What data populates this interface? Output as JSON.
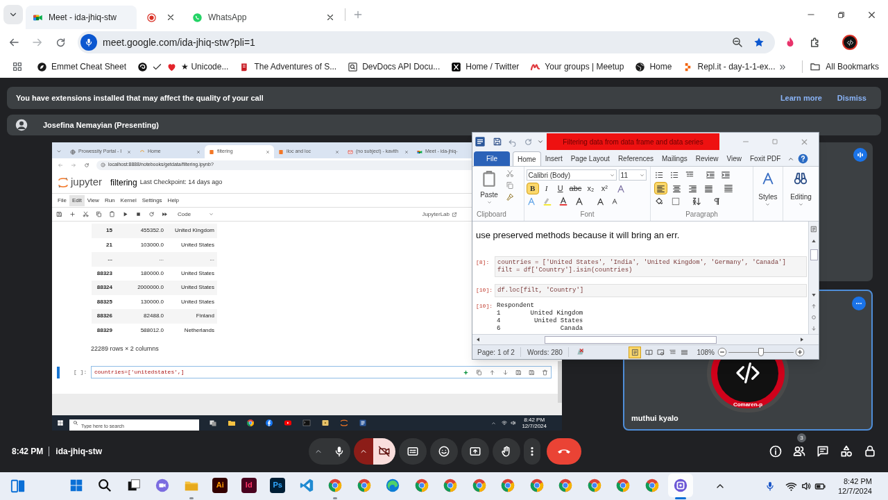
{
  "browser": {
    "tabs": [
      {
        "kind": "meet",
        "title": "Meet - ida-jhiq-stw",
        "selected": true
      },
      {
        "kind": "recording",
        "selected": false
      },
      {
        "kind": "whatsapp",
        "title": "WhatsApp",
        "selected": false
      }
    ],
    "address": "meet.google.com/ida-jhiq-stw?pli=1",
    "bookmarks": [
      {
        "kind": "emmet",
        "label": "Emmet Cheat Sheet"
      },
      {
        "kind": "unicode",
        "label": "★ Unicode..."
      },
      {
        "kind": "pg",
        "label": "The Adventures of S..."
      },
      {
        "kind": "devdocs",
        "label": "DevDocs API Docu..."
      },
      {
        "kind": "x",
        "label": "Home / Twitter"
      },
      {
        "kind": "meetup",
        "label": "Your groups | Meetup"
      },
      {
        "kind": "globe",
        "label": "Home"
      },
      {
        "kind": "replit",
        "label": "Repl.it - day-1-1-ex..."
      }
    ],
    "bookmarks_overflow": "»",
    "all_bookmarks": "All Bookmarks"
  },
  "meet": {
    "notice": {
      "text": "You have extensions installed that may affect the quality of your call",
      "actions": [
        "Learn more",
        "Dismiss"
      ]
    },
    "presenter": "Josefina Nemayian (Presenting)",
    "shared_screen": {
      "tabs": [
        {
          "kind": "globe",
          "title": "Prowessity Portal - I",
          "selected": false
        },
        {
          "kind": "home",
          "title": "Home",
          "selected": false
        },
        {
          "kind": "notebook",
          "title": "filtering",
          "selected": true
        },
        {
          "kind": "notebook",
          "title": "iloc and loc",
          "selected": false
        },
        {
          "kind": "mail",
          "title": "(no subject) - kavith",
          "selected": false
        },
        {
          "kind": "meet",
          "title": "Meet - ida-jhiq-",
          "selected": false
        }
      ],
      "url": "localhost:8888/notebooks/getdata/filtering.ipynb?",
      "app_name": "jupyter",
      "notebook": "filtering",
      "checkpoint": "Last Checkpoint: 14 days ago",
      "menu": [
        {
          "label": "File",
          "selected": false
        },
        {
          "label": "Edit",
          "selected": true
        },
        {
          "label": "View",
          "selected": false
        },
        {
          "label": "Run",
          "selected": false
        },
        {
          "label": "Kernel",
          "selected": false
        },
        {
          "label": "Settings",
          "selected": false
        },
        {
          "label": "Help",
          "selected": false
        }
      ],
      "cell_type": "Code",
      "jupyterlab": "JupyterLab",
      "output_rows": [
        {
          "index": "15",
          "value": "455352.0",
          "country": "United Kingdom"
        },
        {
          "index": "21",
          "value": "103000.0",
          "country": "United States"
        },
        {
          "index": "...",
          "value": "...",
          "country": "..."
        },
        {
          "index": "88323",
          "value": "180000.0",
          "country": "United States"
        },
        {
          "index": "88324",
          "value": "2000000.0",
          "country": "United States"
        },
        {
          "index": "88325",
          "value": "130000.0",
          "country": "United States"
        },
        {
          "index": "88326",
          "value": "82488.0",
          "country": "Finland"
        },
        {
          "index": "88329",
          "value": "588012.0",
          "country": "Netherlands"
        }
      ],
      "shape": "22289 rows × 2 columns",
      "prompt": "[ ]:",
      "code": "countries=['unitedstates',]",
      "search_placeholder": "Type here to search",
      "time": "8:42 PM",
      "date": "12/7/2024"
    },
    "tiles": [
      {
        "speaking": true,
        "selected": false
      },
      {
        "speaking": false,
        "selected": true,
        "name": "muthui kyalo",
        "avatar_text": "Comaren-p"
      }
    ],
    "time": "8:42 PM",
    "meeting_code": "ida-jhiq-stw",
    "controls": [
      {
        "kind": "mic",
        "on": true
      },
      {
        "kind": "camera",
        "on": false
      },
      {
        "kind": "captions",
        "on": false
      },
      {
        "kind": "emoji"
      },
      {
        "kind": "present"
      },
      {
        "kind": "hand",
        "on": false
      },
      {
        "kind": "more"
      },
      {
        "kind": "leave"
      }
    ],
    "side_buttons": [
      {
        "kind": "info"
      },
      {
        "kind": "people",
        "badge": "3"
      },
      {
        "kind": "chat"
      },
      {
        "kind": "activities"
      },
      {
        "kind": "host"
      }
    ]
  },
  "word": {
    "title": "Filtering data from data frame and data series",
    "tabs": [
      {
        "label": "File",
        "kind": "file",
        "selected": false
      },
      {
        "label": "Home",
        "kind": "tab",
        "selected": true
      },
      {
        "label": "Insert",
        "kind": "tab",
        "selected": false
      },
      {
        "label": "Page Layout",
        "kind": "tab",
        "selected": false
      },
      {
        "label": "References",
        "kind": "tab",
        "selected": false
      },
      {
        "label": "Mailings",
        "kind": "tab",
        "selected": false
      },
      {
        "label": "Review",
        "kind": "tab",
        "selected": false
      },
      {
        "label": "View",
        "kind": "tab",
        "selected": false
      },
      {
        "label": "Foxit PDF",
        "kind": "tab",
        "selected": false
      }
    ],
    "paste": "Paste",
    "font": "Calibri (Body)",
    "size": "11",
    "format_buttons": [
      {
        "label": "B",
        "on": true
      },
      {
        "label": "I",
        "on": false
      },
      {
        "label": "U",
        "on": false
      },
      {
        "label": "abc",
        "on": false
      },
      {
        "label": "x₂",
        "on": false
      },
      {
        "label": "x²",
        "on": false
      }
    ],
    "align": [
      {
        "kind": "left",
        "selected": true
      },
      {
        "kind": "center",
        "selected": false
      },
      {
        "kind": "right",
        "selected": false
      },
      {
        "kind": "justify",
        "selected": false
      }
    ],
    "styles": "Styles",
    "editing": "Editing",
    "groups": [
      "Clipboard",
      "Font",
      "Paragraph"
    ],
    "paragraph": "use preserved methods because it will bring an err.",
    "cells": [
      {
        "kind": "input",
        "prompt": "[8]:",
        "lines": [
          "countries = ['United States', 'India', 'United Kingdom', 'Germany', 'Canada']",
          "filt = df['Country'].isin(countries)"
        ]
      },
      {
        "kind": "input",
        "prompt": "[10]:",
        "lines": [
          "df.loc[filt, 'Country']"
        ]
      },
      {
        "kind": "output",
        "prompt": "[10]:",
        "lines": [
          "Respondent",
          "1        United Kingdom",
          "4         United States",
          "6                Canada"
        ]
      }
    ],
    "page": "Page: 1 of 2",
    "words": "Words: 280",
    "zoom": "108%",
    "level": 0.5
  },
  "taskbar": {
    "apps": [
      {
        "kind": "start",
        "running": false,
        "selected": false
      },
      {
        "kind": "search",
        "running": false,
        "selected": false
      },
      {
        "kind": "taskview",
        "running": false,
        "selected": false
      },
      {
        "kind": "chat",
        "running": false,
        "selected": false
      },
      {
        "kind": "explorer",
        "running": true,
        "selected": false
      },
      {
        "kind": "ai",
        "label": "Ai",
        "running": false,
        "selected": false
      },
      {
        "kind": "id",
        "label": "Id",
        "running": false,
        "selected": false
      },
      {
        "kind": "ps",
        "label": "Ps",
        "running": false,
        "selected": false
      },
      {
        "kind": "vscode",
        "running": false,
        "selected": false
      },
      {
        "kind": "chrome",
        "running": true,
        "selected": false
      },
      {
        "kind": "chrome",
        "running": false,
        "selected": false
      },
      {
        "kind": "edge",
        "running": false,
        "selected": false
      },
      {
        "kind": "chrome",
        "running": false,
        "selected": false
      },
      {
        "kind": "chrome",
        "running": false,
        "selected": false
      },
      {
        "kind": "chrome",
        "running": false,
        "selected": false
      },
      {
        "kind": "chrome",
        "running": false,
        "selected": false
      },
      {
        "kind": "chrome",
        "running": false,
        "selected": false
      },
      {
        "kind": "chrome",
        "running": false,
        "selected": false
      },
      {
        "kind": "chrome",
        "running": false,
        "selected": false
      },
      {
        "kind": "chrome",
        "running": false,
        "selected": false
      },
      {
        "kind": "chrome",
        "running": false,
        "selected": false
      },
      {
        "kind": "meetapp",
        "running": true,
        "selected": true
      }
    ],
    "time": "8:42 PM",
    "date": "12/7/2024"
  }
}
